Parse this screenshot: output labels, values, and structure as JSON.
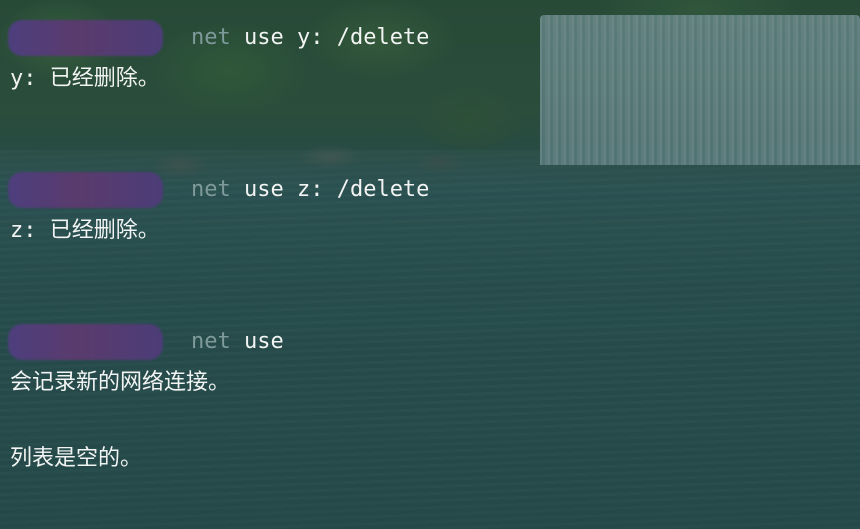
{
  "commands": [
    {
      "prompt_redacted": true,
      "name": "net",
      "args": " use y: /delete",
      "output": "y: 已经删除。"
    },
    {
      "prompt_redacted": true,
      "name": "net",
      "args": " use z: /delete",
      "output": "z: 已经删除。"
    },
    {
      "prompt_redacted": true,
      "name": "net",
      "args": " use",
      "output_lines": [
        "会记录新的网络连接。",
        "列表是空的。"
      ]
    }
  ],
  "colors": {
    "command_name": "#7f9a9a",
    "text": "#f2f4f3",
    "redaction": "#4d3f7d"
  }
}
